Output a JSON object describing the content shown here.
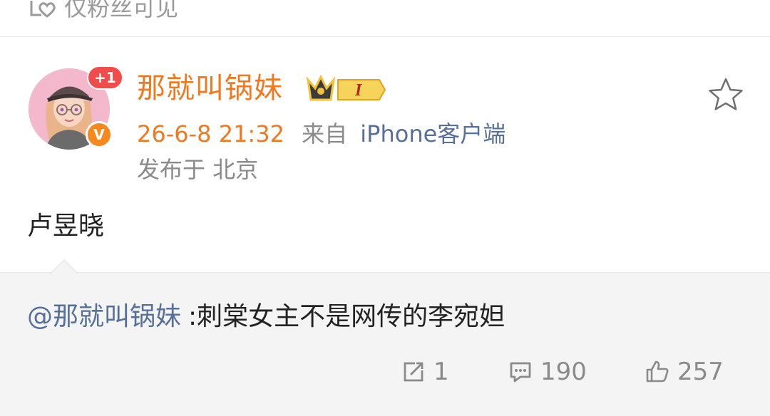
{
  "top": {
    "visibility_label": "仅粉丝可见"
  },
  "post": {
    "author": "那就叫锅妹",
    "plus_badge": "+1",
    "verified_badge": "V",
    "vip_level": "I",
    "time": "26-6-8 21:32",
    "from_label": "来自",
    "client": "iPhone客户端",
    "location": "发布于 北京",
    "text": "卢昱晓"
  },
  "quote": {
    "mention": "@那就叫锅妹",
    "text": ":刺棠女主不是网传的李宛妲"
  },
  "actions": {
    "repost_count": "1",
    "comment_count": "190",
    "like_count": "257"
  },
  "colors": {
    "accent_orange": "#f0791f",
    "link_blue": "#56709a",
    "muted_gray": "#8a8a8a"
  }
}
